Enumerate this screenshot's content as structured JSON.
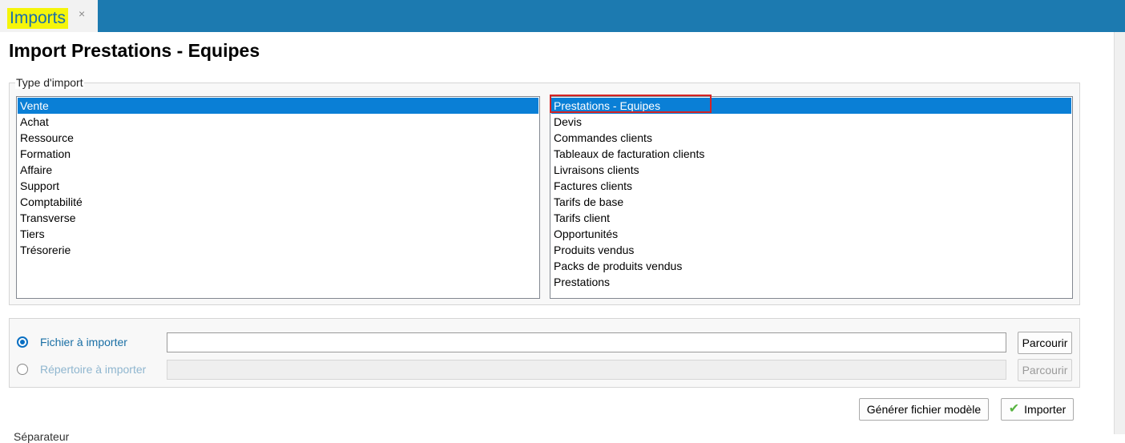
{
  "tab": {
    "title": "Imports",
    "close_glyph": "×"
  },
  "page": {
    "title": "Import Prestations - Equipes"
  },
  "import_type": {
    "legend": "Type d'import",
    "categories": [
      "Vente",
      "Achat",
      "Ressource",
      "Formation",
      "Affaire",
      "Support",
      "Comptabilité",
      "Transverse",
      "Tiers",
      "Trésorerie"
    ],
    "selected_category": "Vente",
    "subtypes": [
      "Prestations - Equipes",
      "Devis",
      "Commandes clients",
      "Tableaux de facturation clients",
      "Livraisons clients",
      "Factures clients",
      "Tarifs de base",
      "Tarifs client",
      "Opportunités",
      "Produits vendus",
      "Packs de produits vendus",
      "Prestations"
    ],
    "selected_subtype": "Prestations - Equipes"
  },
  "source": {
    "file_label": "Fichier à importer",
    "file_value": "",
    "dir_label": "Répertoire à importer",
    "dir_value": "",
    "selected": "file",
    "browse_file_label": "Parcourir",
    "browse_dir_label": "Parcourir"
  },
  "actions": {
    "generate_label": "Générer fichier modèle",
    "import_label": "Importer",
    "import_icon": "check-icon"
  },
  "footer": {
    "label": "Séparateur"
  },
  "colors": {
    "topbar": "#1c7ab0",
    "tab_highlight": "#f5f50a",
    "selection": "#0a7fd6",
    "annotation_box": "#d62424",
    "label_blue": "#1a6fa5",
    "label_disabled": "#8fb6cf"
  }
}
